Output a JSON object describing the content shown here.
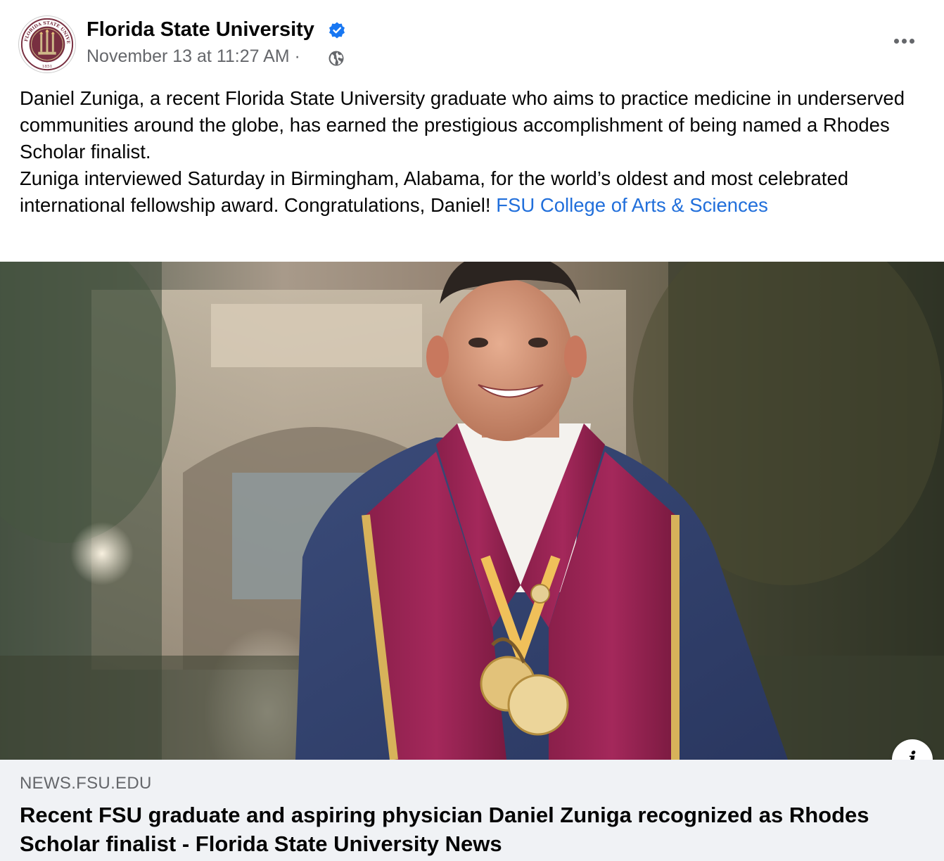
{
  "post": {
    "page_name": "Florida State University",
    "verified_icon": "verified-badge-icon",
    "timestamp": "November 13 at 11:27 AM",
    "separator": "·",
    "audience_icon": "globe-icon",
    "seal": {
      "top_text": "FLORIDA STATE UNIVERSITY",
      "year": "1851"
    },
    "more_icon": "more-options-icon",
    "text_paragraph_1": "Daniel Zuniga, a recent Florida State University graduate who aims to practice medicine in underserved communities around the globe, has earned the prestigious accomplishment of being named a Rhodes Scholar finalist.",
    "text_paragraph_2": "Zuniga interviewed Saturday in Birmingham, Alabama, for the world’s oldest and most celebrated international fellowship award. Congratulations, Daniel!",
    "tag_link": "FSU College of Arts & Sciences"
  },
  "link_preview": {
    "domain": "NEWS.FSU.EDU",
    "title": "Recent FSU graduate and aspiring physician Daniel Zuniga recognized as Rhodes Scholar finalist - Florida State University News",
    "info_icon": "info-icon",
    "info_label": "i"
  },
  "colors": {
    "link_blue": "#216fdb",
    "secondary_text": "#65676b",
    "verified_blue": "#1877f2",
    "garnet": "#782f40",
    "gold": "#ceb888",
    "card_bg": "#f0f2f5"
  }
}
